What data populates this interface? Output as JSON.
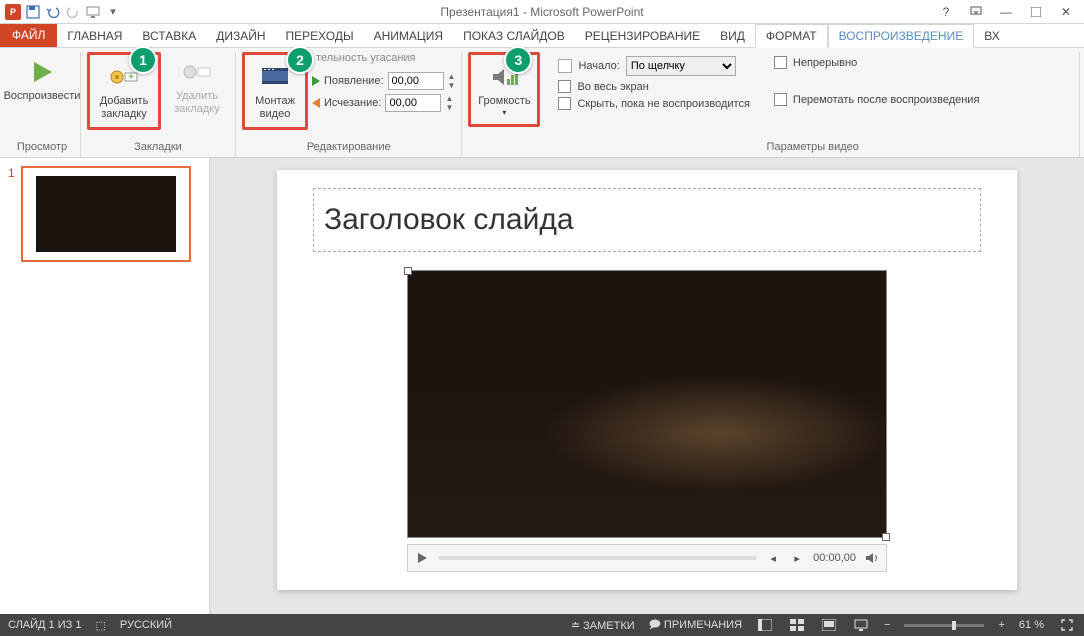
{
  "title": "Презентация1 - Microsoft PowerPoint",
  "tabs": {
    "file": "ФАЙЛ",
    "home": "ГЛАВНАЯ",
    "insert": "ВСТАВКА",
    "design": "ДИЗАЙН",
    "transitions": "ПЕРЕХОДЫ",
    "animations": "АНИМАЦИЯ",
    "slideshow": "ПОКАЗ СЛАЙДОВ",
    "review": "РЕЦЕНЗИРОВАНИЕ",
    "view": "ВИД",
    "format": "ФОРМАТ",
    "playback": "ВОСПРОИЗВЕДЕНИЕ",
    "overflow": "Вх"
  },
  "ribbon": {
    "preview": {
      "btn": "Воспроизвести",
      "group": "Просмотр"
    },
    "bookmarks": {
      "add": "Добавить закладку",
      "remove": "Удалить закладку",
      "group": "Закладки"
    },
    "editing": {
      "trim": "Монтаж видео",
      "fade_title": "тельность угасания",
      "fade_in": "Появление:",
      "fade_in_val": "00,00",
      "fade_out": "Исчезание:",
      "fade_out_val": "00,00",
      "group": "Редактирование"
    },
    "volume": {
      "btn": "Громкость"
    },
    "options": {
      "start_label": "Начало:",
      "start_value": "По щелчку",
      "fullscreen": "Во весь экран",
      "hide": "Скрыть, пока не воспроизводится",
      "loop": "Непрерывно",
      "rewind": "Перемотать после воспроизведения",
      "group": "Параметры видео"
    }
  },
  "callouts": {
    "c1": "1",
    "c2": "2",
    "c3": "3"
  },
  "thumbs": {
    "n1": "1"
  },
  "slide": {
    "title_placeholder": "Заголовок слайда"
  },
  "media": {
    "time": "00:00,00"
  },
  "status": {
    "slide": "СЛАЙД 1 ИЗ 1",
    "lang": "РУССКИЙ",
    "notes": "ЗАМЕТКИ",
    "comments": "ПРИМЕЧАНИЯ",
    "zoom": "61 %"
  }
}
